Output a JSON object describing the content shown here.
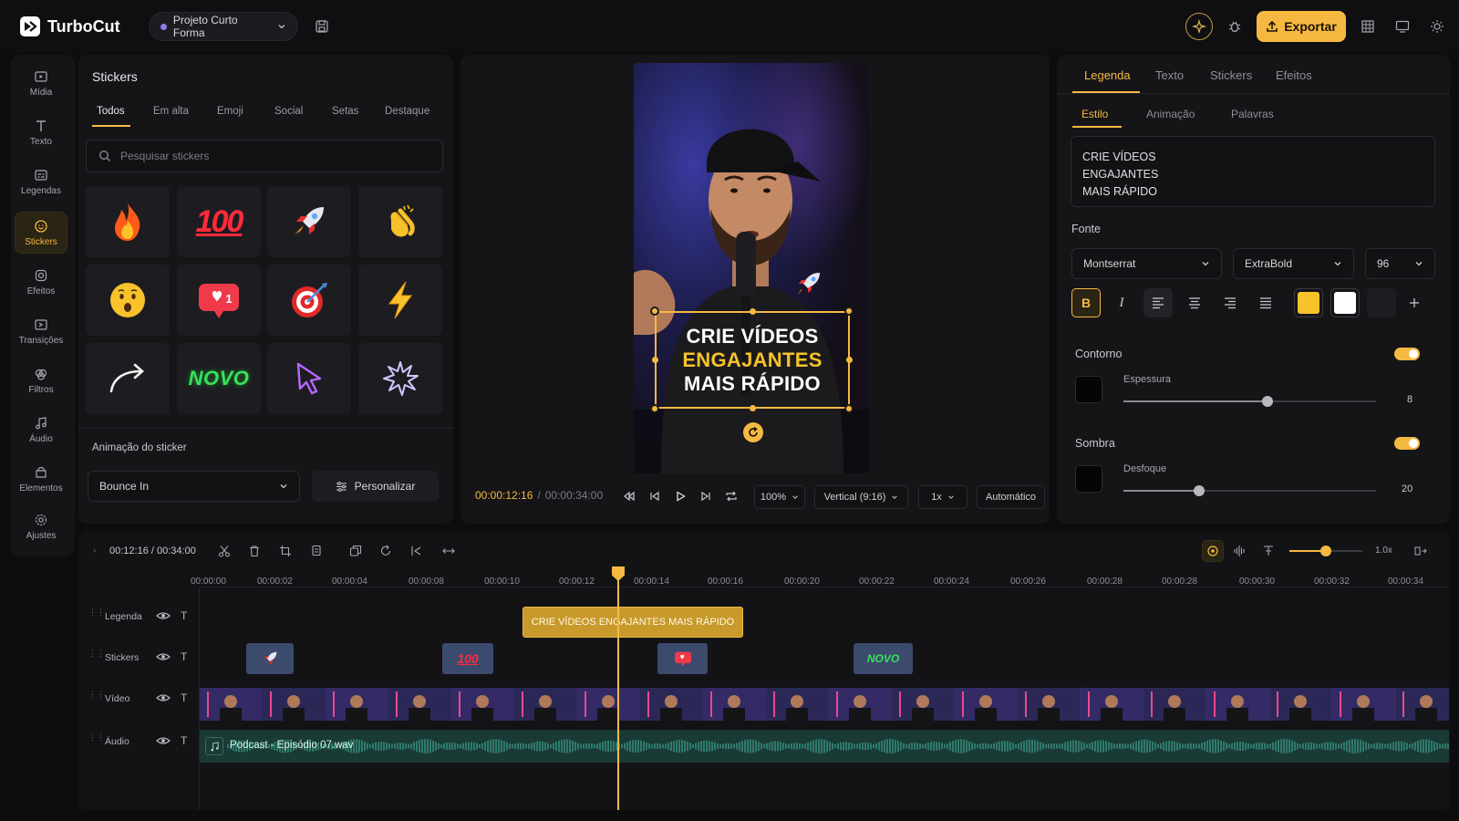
{
  "app": {
    "name": "TurboCut",
    "project": "Projeto Curto Forma",
    "export_label": "Exportar"
  },
  "rail": {
    "items": [
      {
        "label": "Mídia",
        "icon": "media-icon"
      },
      {
        "label": "Texto",
        "icon": "text-icon"
      },
      {
        "label": "Legendas",
        "icon": "captions-icon"
      },
      {
        "label": "Stickers",
        "icon": "sticker-icon",
        "active": true
      },
      {
        "label": "Efeitos",
        "icon": "effects-icon"
      },
      {
        "label": "Transições",
        "icon": "transitions-icon"
      },
      {
        "label": "Filtros",
        "icon": "filters-icon"
      },
      {
        "label": "Áudio",
        "icon": "audio-icon"
      },
      {
        "label": "Elementos",
        "icon": "elements-icon"
      },
      {
        "label": "Ajustes",
        "icon": "settings-icon"
      }
    ]
  },
  "stickers": {
    "title": "Stickers",
    "tabs": [
      "Todos",
      "Em alta",
      "Emoji",
      "Social",
      "Setas",
      "Destaque"
    ],
    "search_placeholder": "Pesquisar stickers",
    "items": [
      "fire",
      "100",
      "rocket",
      "clapping-hands",
      "surprised-face",
      "like-notification",
      "target",
      "lightning",
      "curved-arrow",
      "novo",
      "cursor-arrow",
      "burst"
    ],
    "novo_text": "NOVO",
    "notif_count": "1",
    "hundred_text": "100",
    "animation_label": "Animação do sticker",
    "animation_value": "Bounce In",
    "customize_label": "Personalizar"
  },
  "preview": {
    "caption_lines": [
      "CRIE VÍDEOS",
      "ENGAJANTES",
      "MAIS RÁPIDO"
    ],
    "time_current": "00:00:12:16",
    "time_separator": "/",
    "time_total": "00:00:34:00",
    "zoom": "100%",
    "aspect": "Vertical (9:16)",
    "speed": "1x",
    "auto": "Automático"
  },
  "props": {
    "tabs": [
      "Legenda",
      "Texto",
      "Stickers",
      "Efeitos"
    ],
    "subtabs": [
      "Estilo",
      "Animação",
      "Palavras"
    ],
    "text_lines": [
      "CRIE VÍDEOS",
      "ENGAJANTES",
      "MAIS RÁPIDO"
    ],
    "font_label": "Fonte",
    "font_family": "Montserrat",
    "font_weight": "ExtraBold",
    "font_size": "96",
    "colors": {
      "primary": "#f8c22a",
      "secondary": "#ffffff",
      "accent": "#f5b942"
    },
    "outline_label": "Contorno",
    "outline_on": true,
    "thickness_label": "Espessura",
    "thickness_value": "8",
    "thickness_level": 0.57,
    "shadow_label": "Sombra",
    "shadow_on": true,
    "blur_label": "Desfoque",
    "blur_value": "20",
    "blur_level": 0.3
  },
  "timeline": {
    "time": "00:12:16 / 00:34:00",
    "zoom_label": "1.0x",
    "ticks": [
      "00:00:00",
      "00:00:02",
      "00:00:04",
      "00:00:08",
      "00:00:10",
      "00:00:12",
      "00:00:14",
      "00:00:16",
      "00:00:20",
      "00:00:22",
      "00:00:24",
      "00:00:26",
      "00:00:28",
      "00:00:28",
      "00:00:30",
      "00:00:32",
      "00:00:34"
    ],
    "tracks": [
      "Legenda",
      "Stickers",
      "Vídeo",
      "Áudio"
    ],
    "caption_clip": "CRIE VÍDEOS ENGAJANTES MAIS RÁPIDO",
    "audio_clip": "Podcast - Episódio 07.wav",
    "track_type_glyph": "T"
  }
}
